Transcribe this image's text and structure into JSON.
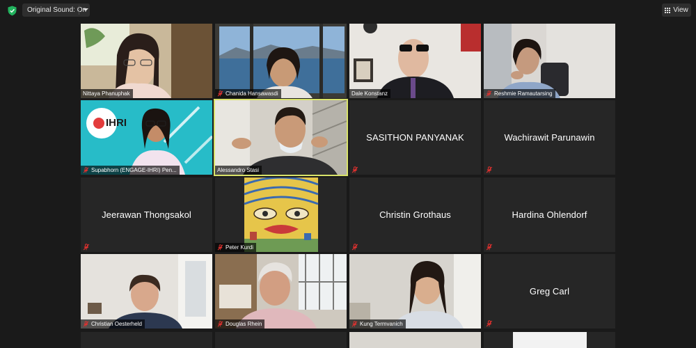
{
  "toolbar": {
    "original_sound_label": "Original Sound: On",
    "view_label": "View"
  },
  "colors": {
    "background": "#1a1a1a",
    "tile": "#262626",
    "active_speaker_border": "#d9e36a",
    "muted_icon": "#e0312f",
    "shield": "#22b35e"
  },
  "participants": [
    {
      "name": "Nittaya Phanuphak",
      "muted": false,
      "video": true
    },
    {
      "name": "Chanida Hansawasdi",
      "muted": true,
      "video": true
    },
    {
      "name": "Dale Konstanz",
      "muted": false,
      "video": true
    },
    {
      "name": "Reshmie Ramautarsing",
      "muted": true,
      "video": true
    },
    {
      "name": "Supabhorn (ENGAGE-IHRI) Pen...",
      "muted": true,
      "video": true,
      "logo_text": "IHRI"
    },
    {
      "name": "Alessandro Stasi",
      "muted": false,
      "video": true,
      "active_speaker": true
    },
    {
      "name": "SASITHON PANYANAK",
      "muted": true,
      "video": false
    },
    {
      "name": "Wachirawit Parunawin",
      "muted": true,
      "video": false
    },
    {
      "name": "Jeerawan Thongsakol",
      "muted": true,
      "video": false
    },
    {
      "name": "Peter Kurdi",
      "muted": true,
      "video": true
    },
    {
      "name": "Christin Grothaus",
      "muted": true,
      "video": false
    },
    {
      "name": "Hardina Ohlendorf",
      "muted": true,
      "video": false
    },
    {
      "name": "Christian Oesterheld",
      "muted": true,
      "video": true
    },
    {
      "name": "Douglas Rhein",
      "muted": true,
      "video": true
    },
    {
      "name": "Kung Termvanich",
      "muted": true,
      "video": true
    },
    {
      "name": "Greg Carl",
      "muted": true,
      "video": false
    }
  ]
}
